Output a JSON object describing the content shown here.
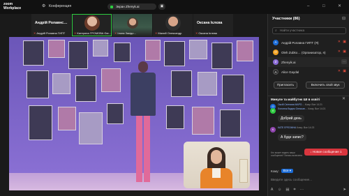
{
  "topbar": {
    "logo_line1": "zoom",
    "logo_line2": "Workplace",
    "conference_label": "Конференция",
    "screen_label": "Экран Zhenyk.ai",
    "window_controls": [
      "–",
      "□",
      "✕"
    ]
  },
  "strip": {
    "tiles": [
      {
        "big_name": "Андрій Ролавнс…",
        "name": "Андрій Ролавна ГИПТ"
      },
      {
        "big_name": "",
        "name": "Катерина ГРОМОВА Євг…"
      },
      {
        "big_name": "",
        "name": "Ілона Закідо…"
      },
      {
        "big_name": "",
        "name": "Малий Олександр"
      },
      {
        "big_name": "Оксана Ієлєва",
        "name": "Оксана Ієлєва"
      }
    ]
  },
  "panel": {
    "title": "Участники (86)",
    "search_placeholder": "Найти участника",
    "participants": [
      {
        "initial": "А",
        "name": "Андрій Ролавна ГИПТ (Я)",
        "color": "#1a6bd6"
      },
      {
        "initial": "О",
        "name": "Oleh Zubko… (Организатор, я)",
        "color": "#f0a020"
      },
      {
        "initial": "Z",
        "name": "Zhenyik.ai",
        "color": "#8a6bd6"
      },
      {
        "initial": "A",
        "name": "Alice Gaydal",
        "color": "#2a2a2a"
      }
    ],
    "invite_label": "Пригласить",
    "unmute_label": "Включить свой звук"
  },
  "chat": {
    "title": "Минуле та майбутнє ШІ в освіті",
    "messages": [
      {
        "initial": "О",
        "color": "#1a6bd6",
        "meta": "Оксій Світлана МАРО…",
        "time": "Кому: Все  14:21",
        "text": ""
      },
      {
        "initial": "Л",
        "color": "#2ecc40",
        "meta": "Лопотюк Вадим Олексан…",
        "time": "Кому: Все  14:21",
        "text": "Добрий день"
      },
      {
        "initial": "К",
        "color": "#8e44ad",
        "meta": "КАТЕ ЕРЕОМНА",
        "time": "Кому: Все  14:23",
        "text": "А буде запис?"
      }
    ],
    "new_messages_label": "↓ Новое сообщение 1",
    "notice": "Кто может видеть ваши сообщения? Запись включена",
    "to_label": "Кому:",
    "to_value": "Все",
    "input_placeholder": "Введите здесь сообщение..."
  }
}
